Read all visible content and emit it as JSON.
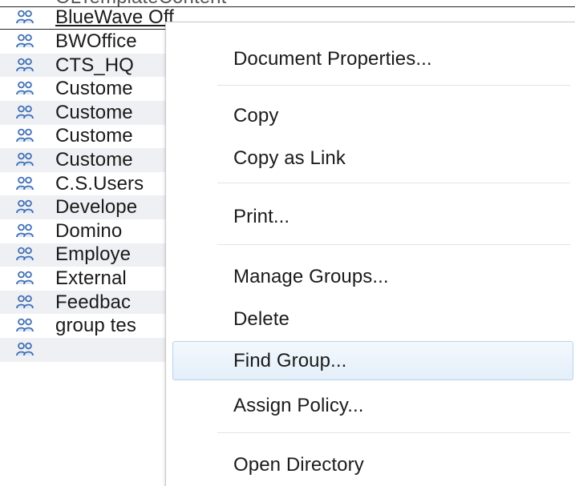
{
  "group_list": {
    "icon": "group-icon",
    "rows": [
      {
        "label": "OLTemplateContent",
        "alt": false
      },
      {
        "label": "BlueWave Off",
        "alt": false,
        "selected": true
      },
      {
        "label": "BWOffice",
        "alt": false
      },
      {
        "label": "CTS_HQ",
        "alt": true
      },
      {
        "label": "Custome",
        "alt": false
      },
      {
        "label": "Custome",
        "alt": true
      },
      {
        "label": "Custome",
        "alt": false
      },
      {
        "label": "Custome",
        "alt": true
      },
      {
        "label": "C.S.Users",
        "alt": false
      },
      {
        "label": "Develope",
        "alt": true
      },
      {
        "label": "Domino",
        "alt": false
      },
      {
        "label": "Employe",
        "alt": true
      },
      {
        "label": "External",
        "alt": false
      },
      {
        "label": "Feedbac",
        "alt": true
      },
      {
        "label": "group tes",
        "alt": false
      },
      {
        "label": "",
        "alt": true
      }
    ]
  },
  "context_menu": {
    "items": [
      {
        "name": "menu-item-document-properties",
        "label": "Document Properties..."
      },
      {
        "name": "menu-item-copy",
        "label": "Copy"
      },
      {
        "name": "menu-item-copy-as-link",
        "label": "Copy as Link"
      },
      {
        "name": "menu-item-print",
        "label": "Print..."
      },
      {
        "name": "menu-item-manage-groups",
        "label": "Manage Groups..."
      },
      {
        "name": "menu-item-delete",
        "label": "Delete"
      },
      {
        "name": "menu-item-find-group",
        "label": "Find Group...",
        "highlighted": true
      },
      {
        "name": "menu-item-assign-policy",
        "label": "Assign Policy..."
      },
      {
        "name": "menu-item-open-directory",
        "label": "Open Directory"
      }
    ],
    "highlight_color": "#e4eff9",
    "highlight_border": "#b8d3ef"
  }
}
